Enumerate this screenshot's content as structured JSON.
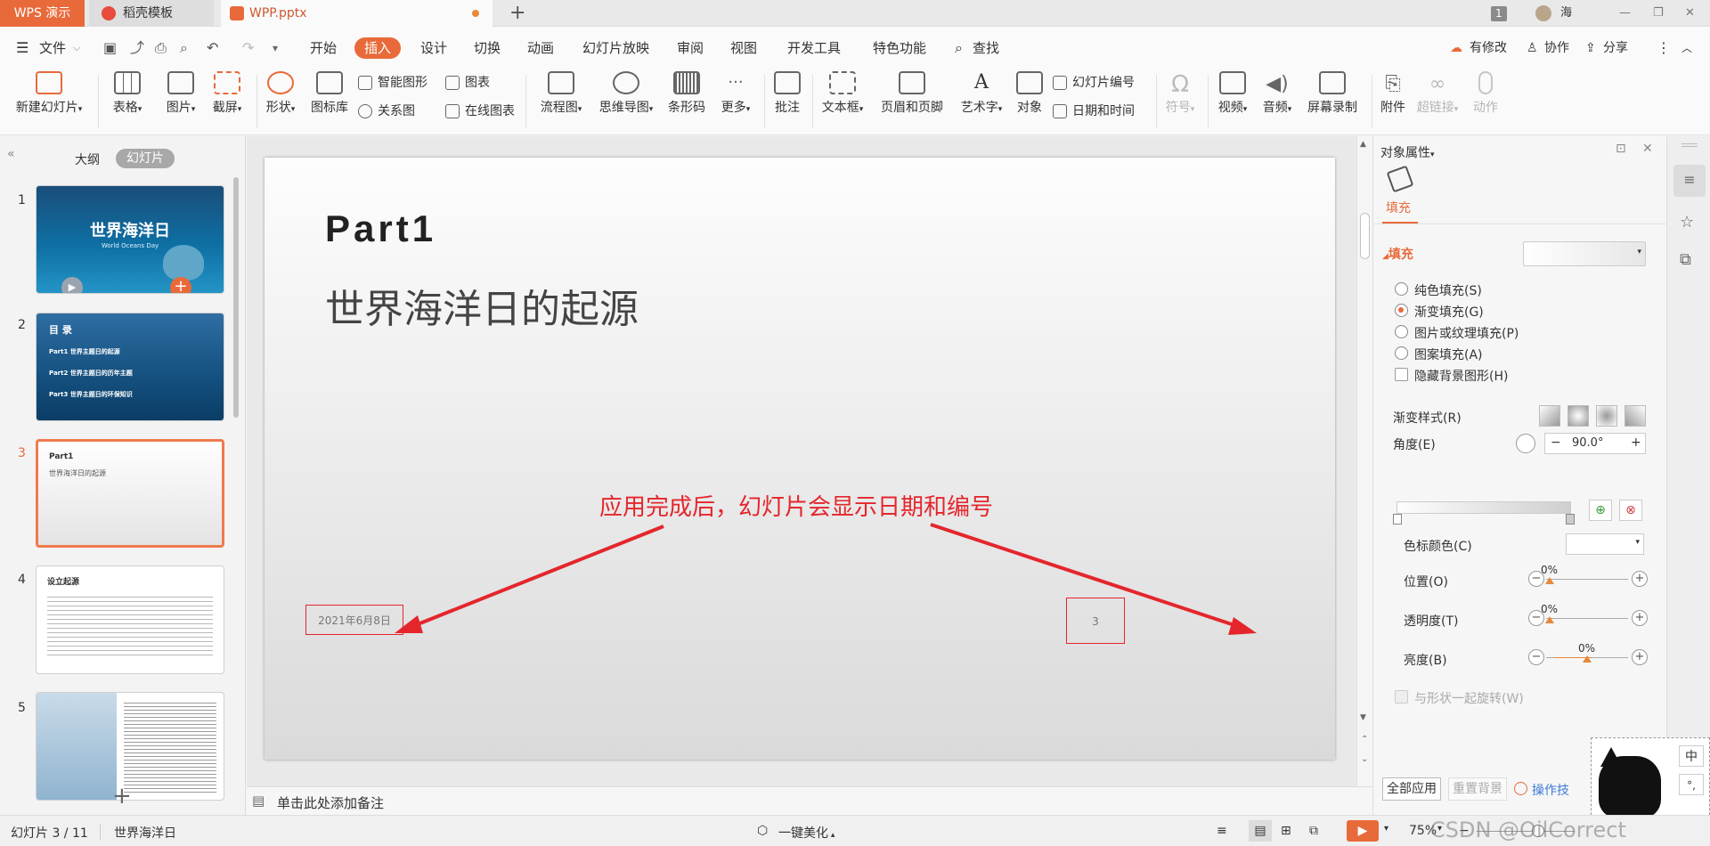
{
  "titlebar": {
    "app_tab": "WPS 演示",
    "template_tab": "稻壳模板",
    "file_tab": "WPP.pptx",
    "new_tab": "+",
    "badge": "1",
    "user": "海"
  },
  "menubar": {
    "file": "文件",
    "items": [
      "开始",
      "插入",
      "设计",
      "切换",
      "动画",
      "幻灯片放映",
      "审阅",
      "视图",
      "开发工具",
      "特色功能"
    ],
    "search": "查找",
    "modify": "有修改",
    "collab": "协作",
    "share": "分享"
  },
  "ribbon": {
    "new_slide": "新建幻灯片",
    "table": "表格",
    "picture": "图片",
    "screenshot": "截屏",
    "shape": "形状",
    "icon_lib": "图标库",
    "smart_art": "智能图形",
    "chart": "图表",
    "relation": "关系图",
    "online_chart": "在线图表",
    "flowchart": "流程图",
    "mindmap": "思维导图",
    "barcode": "条形码",
    "more": "更多",
    "comment": "批注",
    "textbox": "文本框",
    "header_footer": "页眉和页脚",
    "wordart": "艺术字",
    "object": "对象",
    "slide_number": "幻灯片编号",
    "date_time": "日期和时间",
    "symbol": "符号",
    "video": "视频",
    "audio": "音频",
    "screen_record": "屏幕录制",
    "attachment": "附件",
    "hyperlink": "超链接",
    "action": "动作"
  },
  "leftpanel": {
    "outline_tab": "大纲",
    "slides_tab": "幻灯片",
    "slide_numbers": [
      "1",
      "2",
      "3",
      "4",
      "5"
    ],
    "t1": {
      "title": "世界海洋日",
      "sub": "World Oceans Day"
    },
    "t2": {
      "heading": "目 录",
      "items": [
        "Part1  世界主题日的起源",
        "Part2  世界主题日的历年主题",
        "Part3  世界主题日的环保知识"
      ]
    },
    "t3": {
      "title": "Part1",
      "sub": "世界海洋日的起源"
    },
    "t4": {
      "title": "设立起源"
    },
    "add": "+"
  },
  "slide": {
    "title": "Part1",
    "subtitle": "世界海洋日的起源",
    "annotation": "应用完成后，幻灯片会显示日期和编号",
    "date": "2021年6月8日",
    "number": "3"
  },
  "notes": {
    "placeholder": "单击此处添加备注"
  },
  "rightpanel": {
    "header": "对象属性",
    "fill_tab": "填充",
    "fill_section": "填充",
    "options": [
      "纯色填充(S)",
      "渐变填充(G)",
      "图片或纹理填充(P)",
      "图案填充(A)"
    ],
    "selected_option": "渐变填充(G)",
    "hide_bg": "隐藏背景图形(H)",
    "gradient_style": "渐变样式(R)",
    "angle_label": "角度(E)",
    "angle_value": "90.0°",
    "stop_color": "色标颜色(C)",
    "position": "位置(O)",
    "transparency": "透明度(T)",
    "brightness": "亮度(B)",
    "position_value": "0%",
    "transparency_value": "0%",
    "brightness_value": "0%",
    "brightness_level": 0.5,
    "rotate_with_shape": "与形状一起旋转(W)",
    "apply_all": "全部应用",
    "reset_bg": "重置背景",
    "tips": "操作技",
    "ime_char": "中",
    "ime_punct": "°,"
  },
  "statusbar": {
    "slide_info": "幻灯片 3 / 11",
    "theme": "世界海洋日",
    "beautify": "一键美化",
    "zoom": "75%",
    "watermark": "CSDN @OilCorrect"
  },
  "colors": {
    "accent": "#e86a3a",
    "annotation": "#e4262c",
    "selection": "#f07a4d"
  }
}
